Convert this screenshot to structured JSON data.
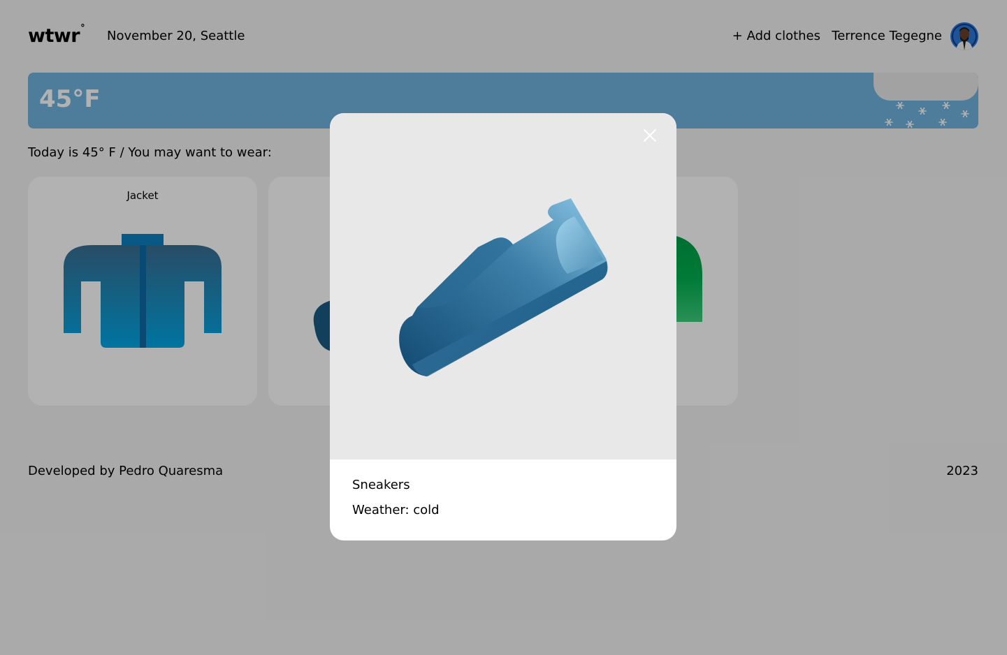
{
  "header": {
    "logo": "wtwr",
    "logo_degree": "°",
    "date_location": "November 20, Seattle",
    "add_clothes_label": "+ Add clothes",
    "username": "Terrence Tegegne"
  },
  "weather": {
    "temperature": "45°F",
    "condition_icon": "snow-cloud-icon"
  },
  "main": {
    "suggestion_text": "Today is 45° F / You may want to wear:",
    "cards": [
      {
        "label": "Jacket",
        "icon": "jacket-icon"
      },
      {
        "label": "",
        "icon": "sneakers-icon"
      },
      {
        "label": "",
        "icon": "hoodie-icon"
      }
    ]
  },
  "footer": {
    "credit": "Developed by Pedro Quaresma",
    "year": "2023"
  },
  "modal": {
    "item_name": "Sneakers",
    "item_weather": "Weather: cold",
    "close_icon": "close-icon"
  },
  "colors": {
    "weather_banner": "#6fb3de",
    "jacket_top": "#3a6e92",
    "jacket_bottom": "#00a7e6",
    "sneaker_dark": "#1b5b84",
    "sneaker_light": "#8ec8e6",
    "hoodie_green": "#00a851"
  }
}
